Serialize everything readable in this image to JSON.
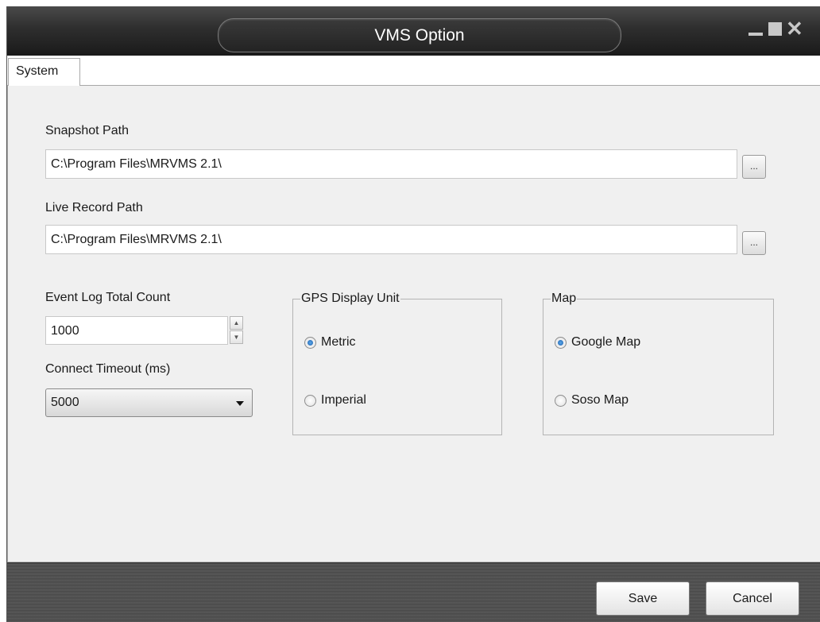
{
  "window": {
    "title": "VMS Option",
    "controls": {
      "minimize_icon": "minimize-icon",
      "maximize_icon": "maximize-icon",
      "close_icon": "close-icon"
    }
  },
  "tabs": [
    {
      "label": "System",
      "active": true
    }
  ],
  "snapshot": {
    "label": "Snapshot Path",
    "value": "C:\\Program Files\\MRVMS 2.1\\",
    "browse_label": "..."
  },
  "live_record": {
    "label": "Live Record Path",
    "value": "C:\\Program Files\\MRVMS 2.1\\",
    "browse_label": "..."
  },
  "event_log": {
    "label": "Event Log Total Count",
    "value": "1000",
    "up_glyph": "▲",
    "down_glyph": "▼"
  },
  "connect_timeout": {
    "label": "Connect Timeout (ms)",
    "selected": "5000"
  },
  "gps_unit": {
    "title": "GPS Display Unit",
    "options": [
      {
        "label": "Metric",
        "checked": true
      },
      {
        "label": "Imperial",
        "checked": false
      }
    ]
  },
  "map": {
    "title": "Map",
    "options": [
      {
        "label": "Google Map",
        "checked": true
      },
      {
        "label": "Soso Map",
        "checked": false
      }
    ]
  },
  "footer": {
    "save_label": "Save",
    "cancel_label": "Cancel"
  },
  "colors": {
    "titlebar": "#2e2e2e",
    "panel": "#f0f0f0",
    "footer": "#4d4d4d",
    "radio_accent": "#1d5fae"
  }
}
